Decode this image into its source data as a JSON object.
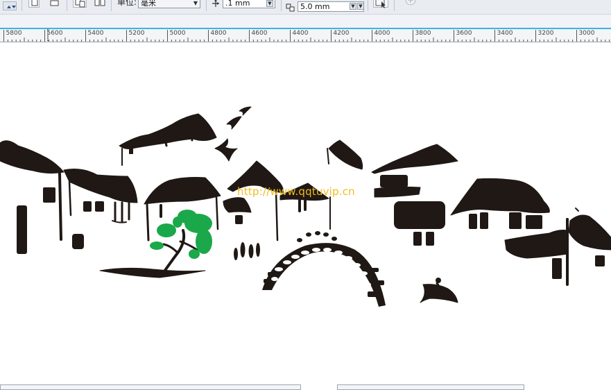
{
  "toolbar": {
    "unit_label": "单位:",
    "unit_value": "毫米",
    "nudge_value": ".1 mm",
    "duplicate_distance_value": "5.0 mm"
  },
  "ruler": {
    "labels": [
      "5800",
      "5600",
      "5400",
      "5200",
      "5000",
      "4800",
      "4600",
      "4400",
      "4200",
      "4000",
      "3800",
      "3600",
      "3400",
      "3200",
      "3000"
    ]
  },
  "canvas": {
    "watermark": "http://www.qqtuvip.cn"
  },
  "colors": {
    "ink": "#1f1814",
    "tree": "#1aa84a",
    "ruler_accent": "#37b5e8",
    "watermark": "#f1bc1b"
  }
}
